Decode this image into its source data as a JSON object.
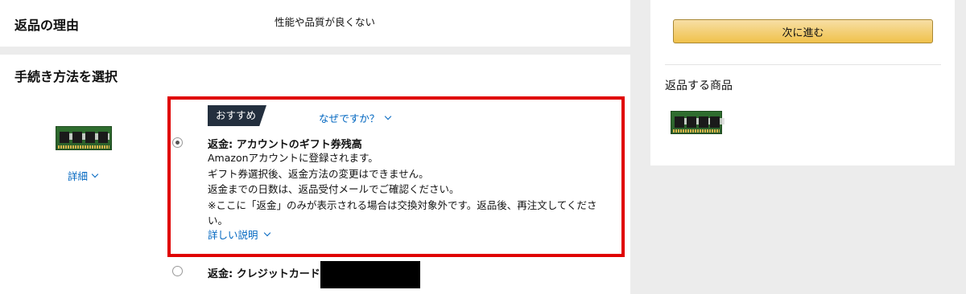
{
  "reason": {
    "title": "返品の理由",
    "value": "性能や品質が良くない"
  },
  "method": {
    "title": "手続き方法を選択",
    "product_detail_link": "詳細",
    "recommended_badge": "おすすめ",
    "why_link": "なぜですか？",
    "options": [
      {
        "title": "返金: アカウントのギフト券残高",
        "selected": true,
        "description_lines": [
          "Amazonアカウントに登録されます。",
          "ギフト券選択後、返金方法の変更はできません。",
          "返金までの日数は、返品受付メールでご確認ください。",
          "※ここに「返金」のみが表示される場合は交換対象外です。返品後、再注文してくださ",
          "い。"
        ],
        "more_link": "詳しい説明"
      },
      {
        "title": "返金: クレジットカード(",
        "selected": false
      }
    ]
  },
  "side": {
    "next_button": "次に進む",
    "return_items_title": "返品する商品"
  },
  "colors": {
    "accent_link": "#0066c0",
    "highlight": "#e00000",
    "badge_bg": "#232f3e",
    "button_gold": "#f0c14b"
  }
}
